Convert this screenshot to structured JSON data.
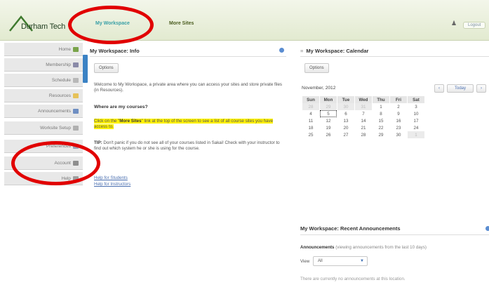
{
  "header": {
    "logo_text": "Durham Tech",
    "tabs": [
      {
        "label": "My Workspace",
        "active": true
      },
      {
        "label": "More Sites",
        "active": false
      }
    ],
    "logout_label": "Logout"
  },
  "sidebar": {
    "items": [
      {
        "label": "Home",
        "icon": "home-icon",
        "color": "#7aa44a"
      },
      {
        "label": "Membership",
        "icon": "membership-icon",
        "color": "#8a8aa8"
      },
      {
        "label": "Schedule",
        "icon": "calendar-icon",
        "color": "#b8b8b8"
      },
      {
        "label": "Resources",
        "icon": "folder-icon",
        "color": "#e6c25a"
      },
      {
        "label": "Announcements",
        "icon": "megaphone-icon",
        "color": "#6f8fc2"
      },
      {
        "label": "Worksite Setup",
        "icon": "setup-icon",
        "color": "#b0b0b0"
      },
      {
        "label": "Preferences",
        "icon": "preferences-icon",
        "color": "#9aa2b6"
      },
      {
        "label": "Account",
        "icon": "lock-icon",
        "color": "#8e8e8e"
      },
      {
        "label": "Help",
        "icon": "help-icon",
        "color": "#9e9e9e"
      }
    ]
  },
  "info": {
    "title": "My Workspace: Info",
    "options_label": "Options",
    "intro": "Welcome to My Workspace, a private area where you can access your sites and store private files (in Resources).",
    "heading": "Where are my courses?",
    "click_pre": "Click on the \"",
    "click_bold": "More Sites",
    "click_post": "\" link at the top of the screen to see a list of all course sites you have access to.",
    "tip_bold": "TIP:",
    "tip_text": " Don't panic if you do not see all of your courses listed in Sakai! Check with your instructor to find out which system he or she is using for the course.",
    "link_students": "Help for Students",
    "link_instructors": "Help for Instructors"
  },
  "calendar": {
    "title": "My Workspace: Calendar",
    "options_label": "Options",
    "month": "November, 2012",
    "today_label": "Today",
    "days": [
      "Sun",
      "Mon",
      "Tue",
      "Wed",
      "Thu",
      "Fri",
      "Sat"
    ],
    "weeks": [
      [
        "28",
        "29",
        "30",
        "31",
        "1",
        "2",
        "3"
      ],
      [
        "4",
        "5",
        "6",
        "7",
        "8",
        "9",
        "10"
      ],
      [
        "11",
        "12",
        "13",
        "14",
        "15",
        "16",
        "17"
      ],
      [
        "18",
        "19",
        "20",
        "21",
        "22",
        "23",
        "24"
      ],
      [
        "25",
        "26",
        "27",
        "28",
        "29",
        "30",
        "1"
      ]
    ]
  },
  "announcements": {
    "title": "My Workspace: Recent Announcements",
    "subtitle_bold": "Announcements",
    "subtitle_text": "(viewing announcements from the last 10 days)",
    "view_label": "View",
    "view_value": "All",
    "empty_text": "There are currently no announcements at this location."
  }
}
